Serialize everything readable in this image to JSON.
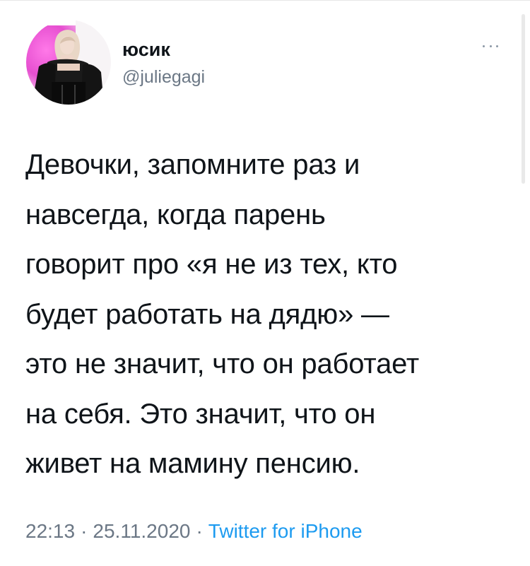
{
  "tweet": {
    "author": {
      "display_name": "юсик",
      "username": "@juliegagi",
      "avatar_icon": "profile-photo",
      "avatar_accent": "#e64fd0"
    },
    "more_icon": "more-horizontal-icon",
    "text_lines": [
      "Девочки, запомните раз и",
      "навсегда, когда парень",
      "говорит про «я не из тех, кто",
      "будет работать на дядю» —",
      "это не значит, что он работает",
      "на себя. Это значит, что он",
      "живет на мамину пенсию."
    ],
    "time": "22:13",
    "date": "25.11.2020",
    "source": "Twitter for iPhone",
    "separator": "·",
    "colors": {
      "text": "#0f1419",
      "secondary": "#6b7785",
      "link": "#1d9bf0"
    }
  }
}
